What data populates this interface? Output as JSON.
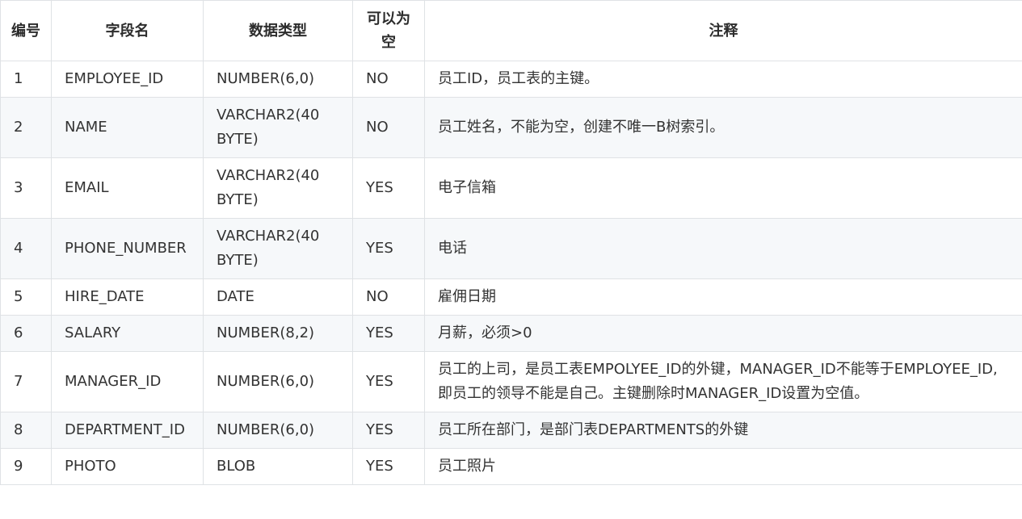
{
  "table": {
    "headers": {
      "no": "编号",
      "field": "字段名",
      "type": "数据类型",
      "nullable": "可以为空",
      "comment": "注释"
    },
    "rows": [
      {
        "no": "1",
        "field": "EMPLOYEE_ID",
        "type": "NUMBER(6,0)",
        "nullable": "NO",
        "comment": "员工ID，员工表的主键。"
      },
      {
        "no": "2",
        "field": "NAME",
        "type": "VARCHAR2(40 BYTE)",
        "nullable": "NO",
        "comment": "员工姓名，不能为空，创建不唯一B树索引。"
      },
      {
        "no": "3",
        "field": "EMAIL",
        "type": "VARCHAR2(40 BYTE)",
        "nullable": "YES",
        "comment": "电子信箱"
      },
      {
        "no": "4",
        "field": "PHONE_NUMBER",
        "type": "VARCHAR2(40 BYTE)",
        "nullable": "YES",
        "comment": "电话"
      },
      {
        "no": "5",
        "field": "HIRE_DATE",
        "type": "DATE",
        "nullable": "NO",
        "comment": "雇佣日期"
      },
      {
        "no": "6",
        "field": "SALARY",
        "type": "NUMBER(8,2)",
        "nullable": "YES",
        "comment": "月薪，必须>0"
      },
      {
        "no": "7",
        "field": "MANAGER_ID",
        "type": "NUMBER(6,0)",
        "nullable": "YES",
        "comment": "员工的上司，是员工表EMPOLYEE_ID的外键，MANAGER_ID不能等于EMPLOYEE_ID,即员工的领导不能是自己。主键删除时MANAGER_ID设置为空值。"
      },
      {
        "no": "8",
        "field": "DEPARTMENT_ID",
        "type": "NUMBER(6,0)",
        "nullable": "YES",
        "comment": "员工所在部门，是部门表DEPARTMENTS的外键"
      },
      {
        "no": "9",
        "field": "PHOTO",
        "type": "BLOB",
        "nullable": "YES",
        "comment": "员工照片"
      }
    ]
  }
}
